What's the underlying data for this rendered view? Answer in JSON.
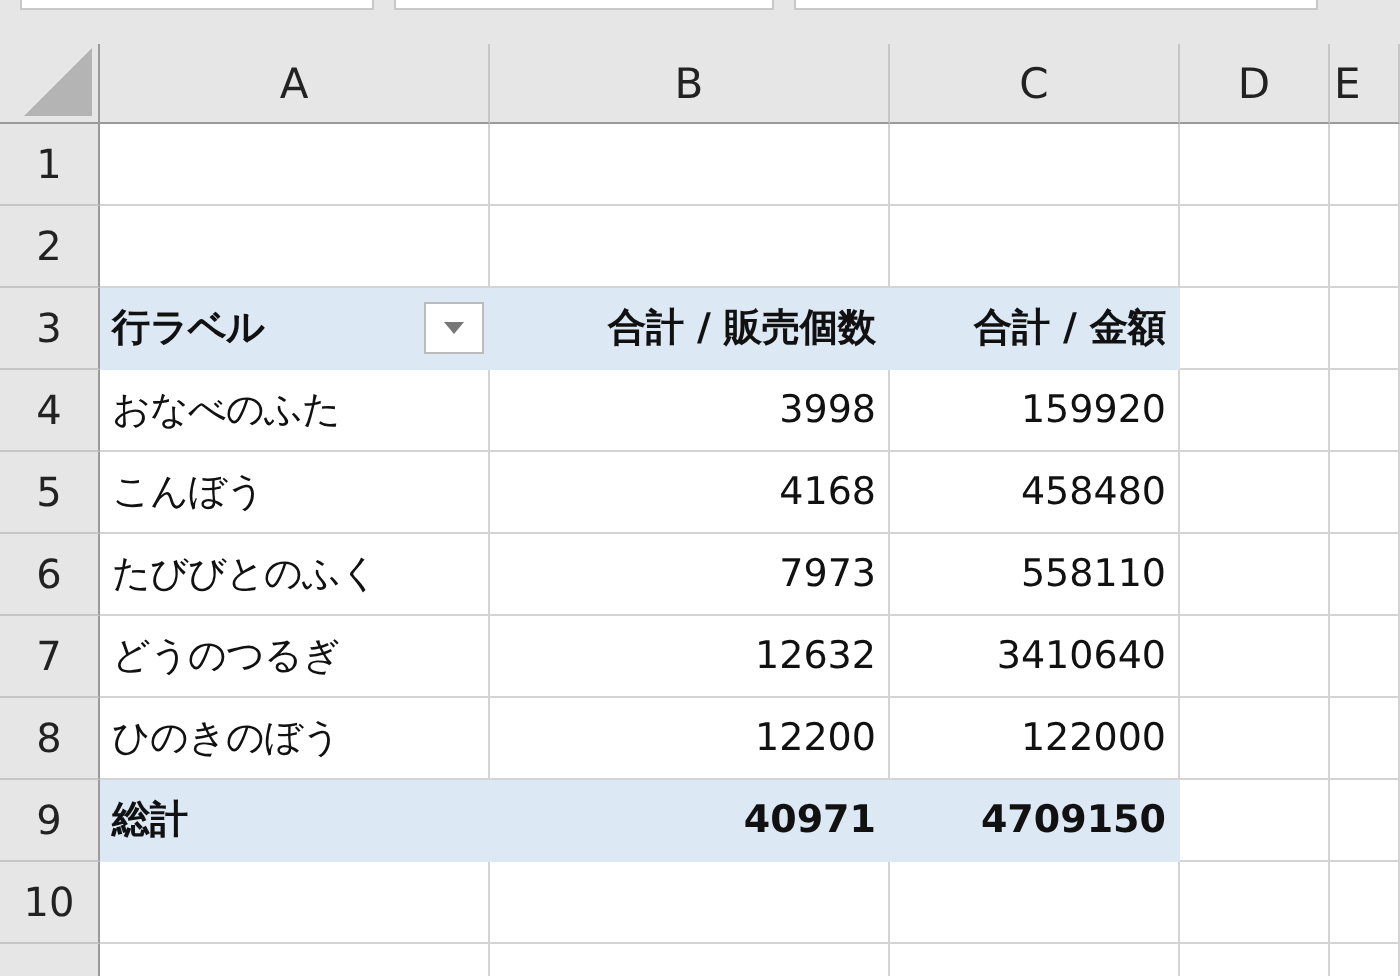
{
  "columns": [
    "A",
    "B",
    "C",
    "D",
    "E"
  ],
  "rows": [
    {
      "number": "1",
      "kind": "empty"
    },
    {
      "number": "2",
      "kind": "empty"
    },
    {
      "number": "3",
      "kind": "header",
      "label": "行ラベル",
      "values": [
        "合計 / 販売個数",
        "合計 / 金額"
      ]
    },
    {
      "number": "4",
      "kind": "item",
      "label": "おなべのふた",
      "values": [
        "3998",
        "159920"
      ]
    },
    {
      "number": "5",
      "kind": "item",
      "label": "こんぼう",
      "values": [
        "4168",
        "458480"
      ]
    },
    {
      "number": "6",
      "kind": "item",
      "label": "たびびとのふく",
      "values": [
        "7973",
        "558110"
      ]
    },
    {
      "number": "7",
      "kind": "item",
      "label": "どうのつるぎ",
      "values": [
        "12632",
        "3410640"
      ]
    },
    {
      "number": "8",
      "kind": "item",
      "label": "ひのきのぼう",
      "values": [
        "12200",
        "122000"
      ]
    },
    {
      "number": "9",
      "kind": "total",
      "label": "総計",
      "values": [
        "40971",
        "4709150"
      ]
    },
    {
      "number": "10",
      "kind": "empty"
    }
  ]
}
